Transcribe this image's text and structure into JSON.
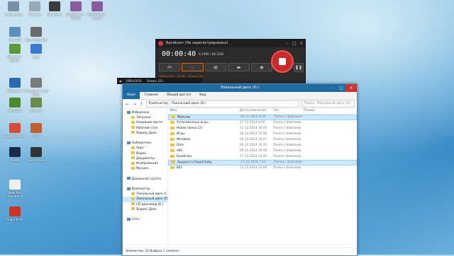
{
  "desktop": {
    "icons": [
      {
        "label": "Компьютер",
        "color": "#7a8fa8"
      },
      {
        "label": "Корзина",
        "color": "#9aa8b8"
      },
      {
        "label": "Bandicam",
        "color": "#3b3b3b"
      },
      {
        "label": "WinRAR.exe - Ярлык",
        "color": "#8a5a9e"
      },
      {
        "label": "WinRAR.exe - Ярлык",
        "color": "#8a5a9e"
      },
      {
        "label": "Ultra ISO",
        "color": "#5a8fc0"
      },
      {
        "label": "Sony Vegas Pro",
        "color": "#6a6a6a"
      },
      {
        "label": "Minecraft - Ярлык",
        "color": "#5a9a3a"
      },
      {
        "label": "Apps",
        "color": "#3a7ad0"
      },
      {
        "label": "Windows 8",
        "color": "#2a6ab0"
      },
      {
        "label": "Assassin's Creed Unity",
        "color": "#7a7a7a"
      },
      {
        "label": "Minecraft",
        "color": "#4a8a2a"
      },
      {
        "label": "Survival",
        "color": "#6a8a4a"
      },
      {
        "label": "Google Chrome",
        "color": "#d84a3a"
      },
      {
        "label": "DVD",
        "color": "#c06030"
      },
      {
        "label": "Steam",
        "color": "#1a2a4a"
      },
      {
        "label": "Ghost Recon",
        "color": "#333"
      },
      {
        "label": "New Text Document",
        "color": "#f0f0f0"
      },
      {
        "label": "Angry Birds",
        "color": "#c32"
      }
    ]
  },
  "bandicam": {
    "title": "Bandicam (Не зарегистрировано)",
    "timer": "00:00:40",
    "size": "6.1MB / 80.5GB",
    "info": "1680x1050 - 30 fps - Запись (D:)"
  },
  "recbar": {
    "resolution": "1680x1050",
    "label": "Запись (D:)"
  },
  "explorer": {
    "title": "Локальный диск (D:)",
    "ribbon": [
      "Файл",
      "Главная",
      "Общий доступ",
      "Вид"
    ],
    "path": "Компьютер › Локальный диск (D:)",
    "search_placeholder": "Поиск: Локальный диск (D:)",
    "nav": [
      "Избранное",
      "Загрузки",
      "Недавние места",
      "Рабочий стол",
      "Яндекс.Диск",
      "",
      "Библиотеки",
      "Apps",
      "Видео",
      "Документы",
      "Изображения",
      "Музыка",
      "",
      "Домашняя группа",
      "",
      "Компьютер",
      "Локальный диск (C",
      "Локальный диск (D",
      "CD-дисковод (E:)",
      "Яндекс.Диск",
      "",
      "Сеть"
    ],
    "columns": [
      "Имя",
      "Дата изменения",
      "Тип",
      "Размер"
    ],
    "rows": [
      {
        "name": "Фильмы",
        "date": "02.11.2014 9:24",
        "type": "Папка с файлами",
        "size": ""
      },
      {
        "name": "Установочные игры",
        "date": "17.12.2014 9:56",
        "type": "Папка с файлами",
        "size": ""
      },
      {
        "name": "Новая папка (2)",
        "date": "13.12.2014 16:05",
        "type": "Папка с файлами",
        "size": ""
      },
      {
        "name": "Игры",
        "date": "16.12.2014 19:56",
        "type": "Папка с файлами",
        "size": ""
      },
      {
        "name": "Windows",
        "date": "04.12.2014 10:47",
        "type": "Папка с файлами",
        "size": ""
      },
      {
        "name": "Dres",
        "date": "03.11.2014 10:13",
        "type": "Папка с файлами",
        "size": ""
      },
      {
        "name": "dkfj",
        "date": "09.11.2014 16:09",
        "type": "Папка с файлами",
        "size": ""
      },
      {
        "name": "Bandicam",
        "date": "17.12.2014 13:21",
        "type": "Папка с файлами",
        "size": ""
      },
      {
        "name": "Assassin's Creed Unity",
        "date": "17.12.2014 7:12",
        "type": "Папка с файлами",
        "size": ""
      },
      {
        "name": "801",
        "date": "13.12.2014 13:06",
        "type": "Папка с файлами",
        "size": ""
      }
    ],
    "status": "Элементов: 10    Выбран 1 элемент"
  }
}
